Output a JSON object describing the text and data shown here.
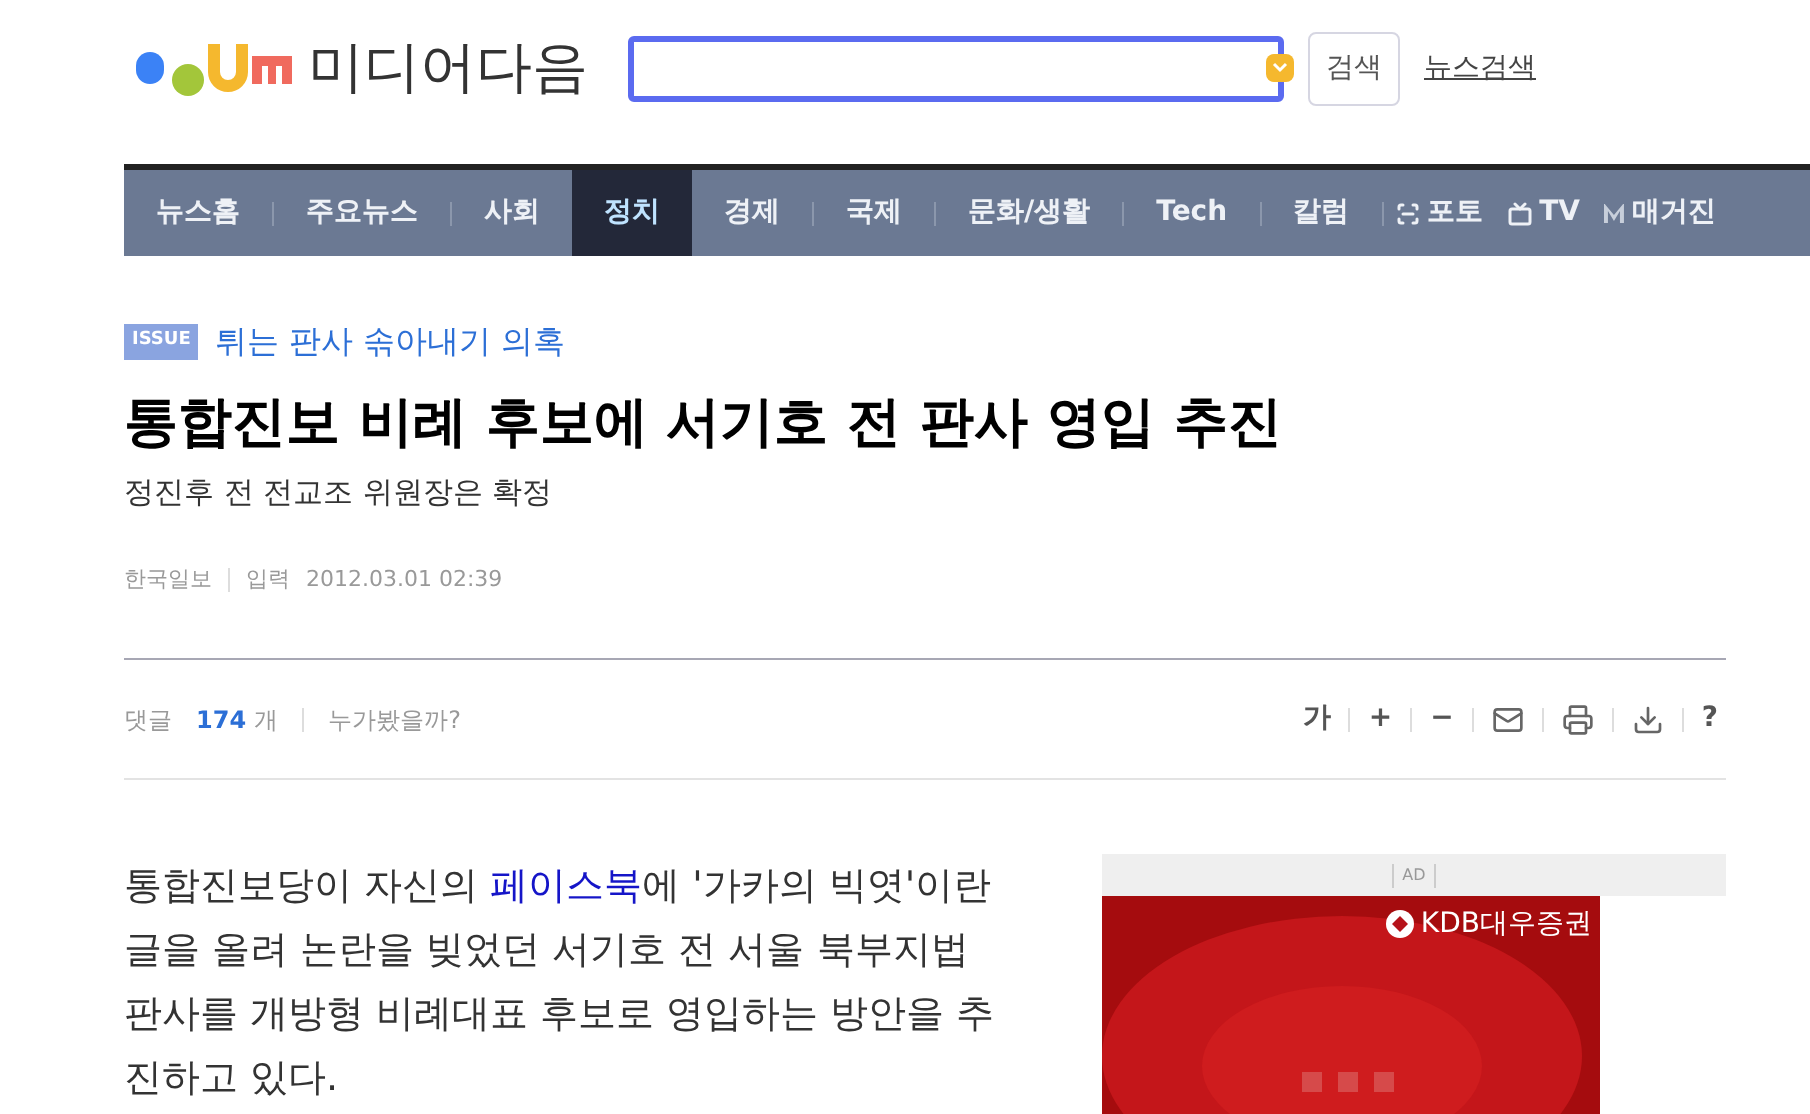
{
  "header": {
    "logo": "미디어다음",
    "search_button": "검색",
    "news_search_link": "뉴스검색"
  },
  "nav": [
    {
      "kind": "section",
      "label": "뉴스홈",
      "selected": false
    },
    {
      "kind": "section",
      "label": "주요뉴스",
      "selected": false
    },
    {
      "kind": "section",
      "label": "사회",
      "selected": false
    },
    {
      "kind": "section",
      "label": "정치",
      "selected": true
    },
    {
      "kind": "section",
      "label": "경제",
      "selected": false
    },
    {
      "kind": "section",
      "label": "국제",
      "selected": false
    },
    {
      "kind": "section",
      "label": "문화/생활",
      "selected": false
    },
    {
      "kind": "section",
      "label": "Tech",
      "selected": false
    },
    {
      "kind": "section",
      "label": "칼럼",
      "selected": false
    },
    {
      "label": "포토",
      "selected": false
    },
    {
      "kind": "tv",
      "label": "TV",
      "selected": false
    },
    {
      "kind": "magazine",
      "label": "매거진",
      "selected": false
    }
  ],
  "issue": {
    "badge": "ISSUE",
    "title": "튀는 판사 솎아내기 의혹"
  },
  "article": {
    "headline": "통합진보 비례 후보에 서기호 전 판사 영입 추진",
    "subheadline": "정진후 전 전교조 위원장은 확정",
    "source": "한국일보",
    "input_label": "입력",
    "datetime": "2012.03.01 02:39"
  },
  "comments": {
    "label": "댓글",
    "count": "174",
    "unit": "개",
    "who_viewed": "누가봤을까?"
  },
  "tools": [
    {
      "kind": "text",
      "label": "가"
    },
    {
      "kind": "text",
      "label": "+"
    },
    {
      "kind": "text",
      "label": "−"
    },
    {
      "kind": "mail"
    },
    {
      "kind": "print"
    },
    {
      "kind": "download"
    },
    {
      "kind": "text",
      "label": "?"
    }
  ],
  "body": {
    "before": "통합진보당이 자신의 ",
    "link": "페이스북",
    "after": "에 '가카의 빅엿'이란 글을 올려 논란을 빚었던 서기호 전 서울 북부지법 판사를 개방형 비례대표 후보로 영입하는 방안을 추진하고 있다."
  },
  "ad": {
    "label": "AD",
    "brand": "KDB대우증권"
  }
}
